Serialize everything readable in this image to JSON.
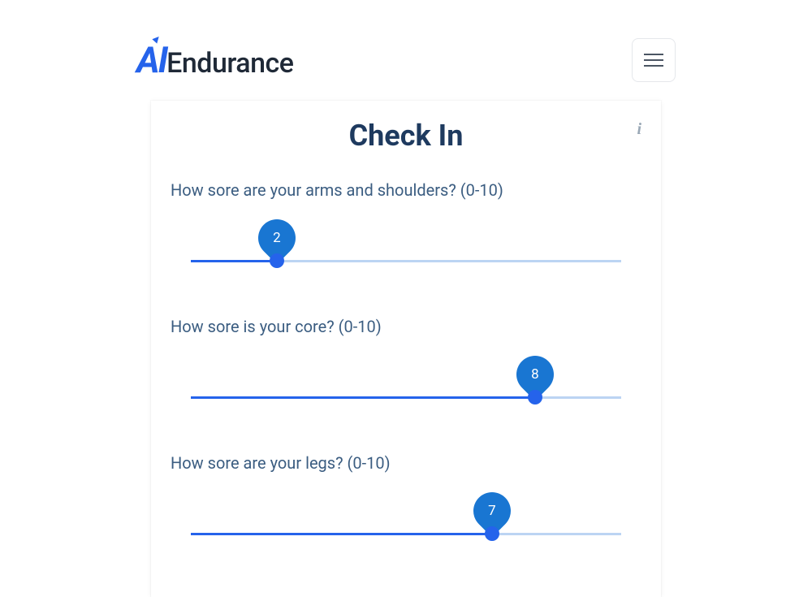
{
  "brand": {
    "mark": "AI",
    "text": "Endurance"
  },
  "panel": {
    "title": "Check In"
  },
  "questions": [
    {
      "label": "How sore are your arms and shoulders? (0-10)",
      "value": 2,
      "min": 0,
      "max": 10
    },
    {
      "label": "How sore is your core? (0-10)",
      "value": 8,
      "min": 0,
      "max": 10
    },
    {
      "label": "How sore are your legs? (0-10)",
      "value": 7,
      "min": 0,
      "max": 10
    }
  ],
  "colors": {
    "accent": "#2563eb",
    "balloon": "#1976d2",
    "track": "#bcd4f3",
    "title": "#1e3a5f",
    "label": "#3b5d81"
  }
}
